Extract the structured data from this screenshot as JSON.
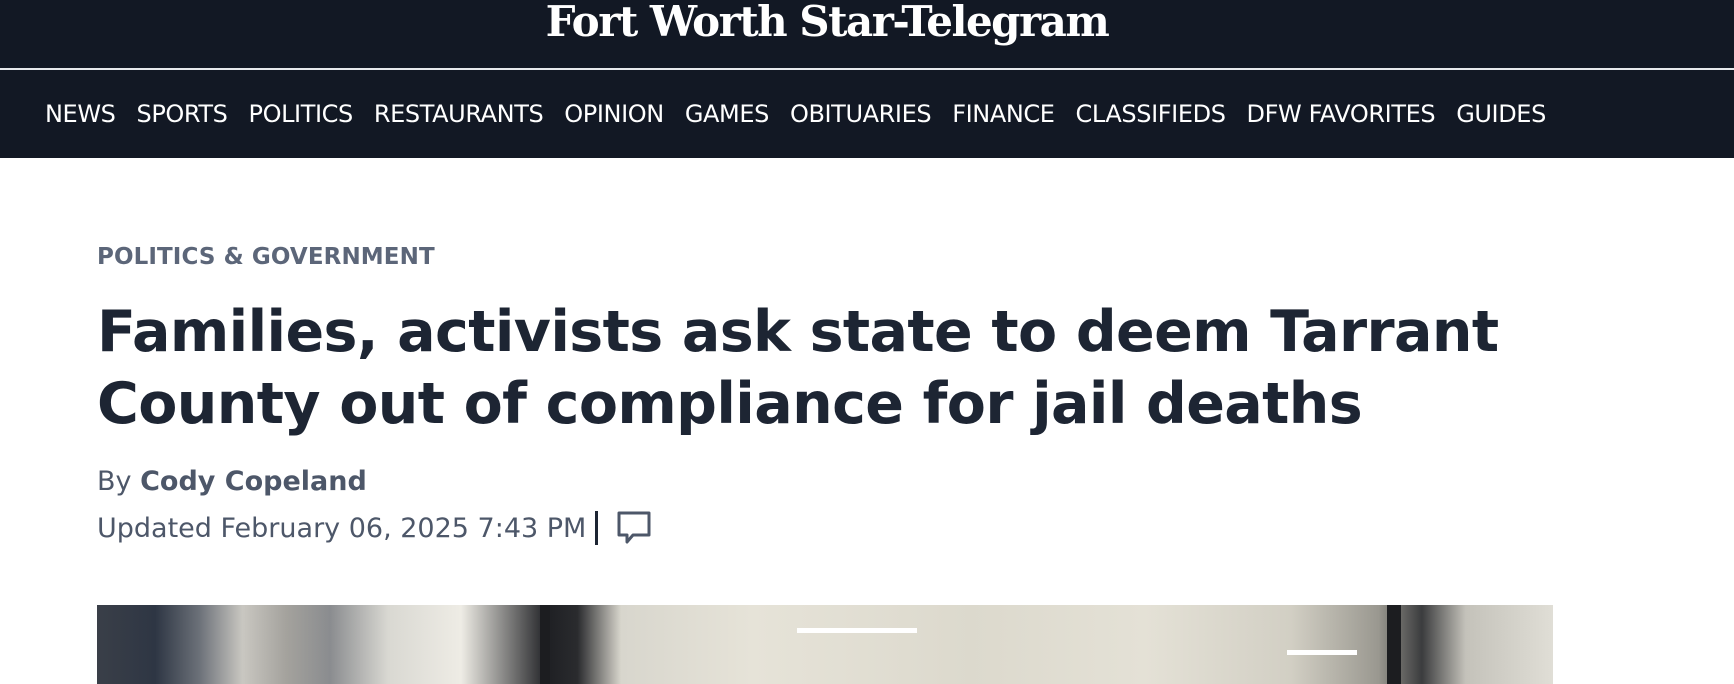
{
  "site": {
    "logo_text": "Fort Worth Star-Telegram"
  },
  "nav": {
    "items": [
      {
        "label": "NEWS"
      },
      {
        "label": "SPORTS"
      },
      {
        "label": "POLITICS"
      },
      {
        "label": "RESTAURANTS"
      },
      {
        "label": "OPINION"
      },
      {
        "label": "GAMES"
      },
      {
        "label": "OBITUARIES"
      },
      {
        "label": "FINANCE"
      },
      {
        "label": "CLASSIFIEDS"
      },
      {
        "label": "DFW FAVORITES"
      },
      {
        "label": "GUIDES"
      }
    ]
  },
  "article": {
    "section": "POLITICS & GOVERNMENT",
    "headline": "Families, activists ask state to deem Tarrant County out of compliance for jail deaths",
    "byline_prefix": "By",
    "author": "Cody Copeland",
    "updated": "Updated February 06, 2025 7:43 PM",
    "comment_icon": "speech-bubble-icon"
  },
  "colors": {
    "nav_background": "#121824",
    "headline": "#1d2533",
    "meta_text": "#4d5769",
    "section_label": "#5c6679"
  }
}
